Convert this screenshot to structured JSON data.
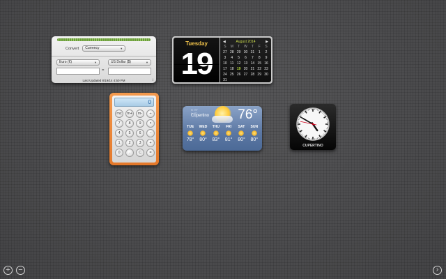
{
  "converter": {
    "convert_label": "Convert",
    "convert_value": "Currency",
    "from_unit": "Euro (€)",
    "to_unit": "US Dollar ($)",
    "equals": "=",
    "updated": "Last Updated 8/19/14 4:50 PM",
    "info": "i"
  },
  "calendar": {
    "weekday": "Tuesday",
    "date": "19",
    "month_title": "August 2014",
    "prev": "◀",
    "next": "▶",
    "headers": [
      "S",
      "M",
      "T",
      "W",
      "T",
      "F",
      "S"
    ],
    "weeks": [
      [
        "27",
        "28",
        "29",
        "30",
        "31",
        "1",
        "2"
      ],
      [
        "3",
        "4",
        "5",
        "6",
        "7",
        "8",
        "9"
      ],
      [
        "10",
        "11",
        "12",
        "13",
        "14",
        "15",
        "16"
      ],
      [
        "17",
        "18",
        "19",
        "20",
        "21",
        "22",
        "23"
      ],
      [
        "24",
        "25",
        "26",
        "27",
        "28",
        "29",
        "30"
      ],
      [
        "31",
        "",
        "",
        "",
        "",
        "",
        ""
      ]
    ],
    "today": "19"
  },
  "calculator": {
    "display": "0",
    "keys": [
      [
        "mc",
        "m+",
        "m-",
        "÷"
      ],
      [
        "7",
        "8",
        "9",
        "×"
      ],
      [
        "4",
        "5",
        "6",
        "−"
      ],
      [
        "1",
        "2",
        "3",
        "+"
      ],
      [
        "0",
        ".",
        "C",
        "="
      ]
    ]
  },
  "weather": {
    "hi": "H: 79°",
    "lo": "L: 61°",
    "city": "Cupertino",
    "temp": "76°",
    "forecast": [
      {
        "day": "TUE",
        "temp": "78°"
      },
      {
        "day": "WED",
        "temp": "80°"
      },
      {
        "day": "THU",
        "temp": "83°"
      },
      {
        "day": "FRI",
        "temp": "81°"
      },
      {
        "day": "SAT",
        "temp": "80°"
      },
      {
        "day": "SUN",
        "temp": "80°"
      }
    ]
  },
  "clock": {
    "city": "CUPERTINO",
    "hour": 4,
    "minute": 50,
    "second": 47
  },
  "controls": {
    "add": "+",
    "remove": "−",
    "next": "›"
  }
}
